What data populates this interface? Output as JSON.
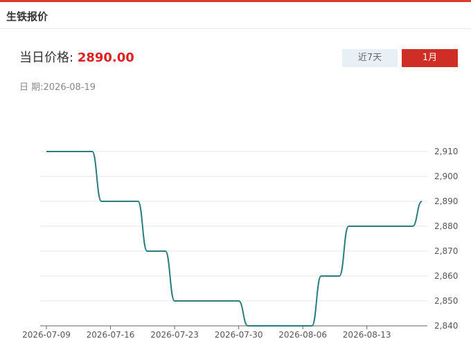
{
  "header": {
    "title": "生铁报价"
  },
  "price": {
    "label": "当日价格:",
    "value": "2890.00"
  },
  "date": {
    "label": "日 期:",
    "value": "2026-08-19"
  },
  "range_tabs": {
    "week": "近7天",
    "month": "1月",
    "active": "1月"
  },
  "colors": {
    "accent": "#cf2e25",
    "line": "#2a7d7c",
    "price": "#e02020"
  },
  "chart_data": {
    "type": "line",
    "title": "",
    "xlabel": "",
    "ylabel": "",
    "ylim": [
      2840,
      2910
    ],
    "y_ticks": [
      "2,840",
      "2,850",
      "2,860",
      "2,870",
      "2,880",
      "2,890",
      "2,900",
      "2,910"
    ],
    "x_ticks": [
      "2026-07-09",
      "2026-07-16",
      "2026-07-23",
      "2026-07-30",
      "2026-08-06",
      "2026-08-13"
    ],
    "grid": true,
    "series": [
      {
        "x": [
          "2026-07-09",
          "2026-07-10",
          "2026-07-11",
          "2026-07-12",
          "2026-07-13",
          "2026-07-14",
          "2026-07-15",
          "2026-07-16",
          "2026-07-17",
          "2026-07-18",
          "2026-07-19",
          "2026-07-20",
          "2026-07-21",
          "2026-07-22",
          "2026-07-23",
          "2026-07-24",
          "2026-07-25",
          "2026-07-26",
          "2026-07-27",
          "2026-07-28",
          "2026-07-29",
          "2026-07-30",
          "2026-07-31",
          "2026-08-01",
          "2026-08-02",
          "2026-08-03",
          "2026-08-04",
          "2026-08-05",
          "2026-08-06",
          "2026-08-07",
          "2026-08-08",
          "2026-08-09",
          "2026-08-10",
          "2026-08-11",
          "2026-08-12",
          "2026-08-13",
          "2026-08-14",
          "2026-08-15",
          "2026-08-16",
          "2026-08-17",
          "2026-08-18",
          "2026-08-19"
        ],
        "values": [
          2910,
          2910,
          2910,
          2910,
          2910,
          2910,
          2890,
          2890,
          2890,
          2890,
          2890,
          2870,
          2870,
          2870,
          2850,
          2850,
          2850,
          2850,
          2850,
          2850,
          2850,
          2850,
          2840,
          2840,
          2840,
          2840,
          2840,
          2840,
          2840,
          2840,
          2860,
          2860,
          2860,
          2880,
          2880,
          2880,
          2880,
          2880,
          2880,
          2880,
          2880,
          2890
        ]
      }
    ]
  }
}
